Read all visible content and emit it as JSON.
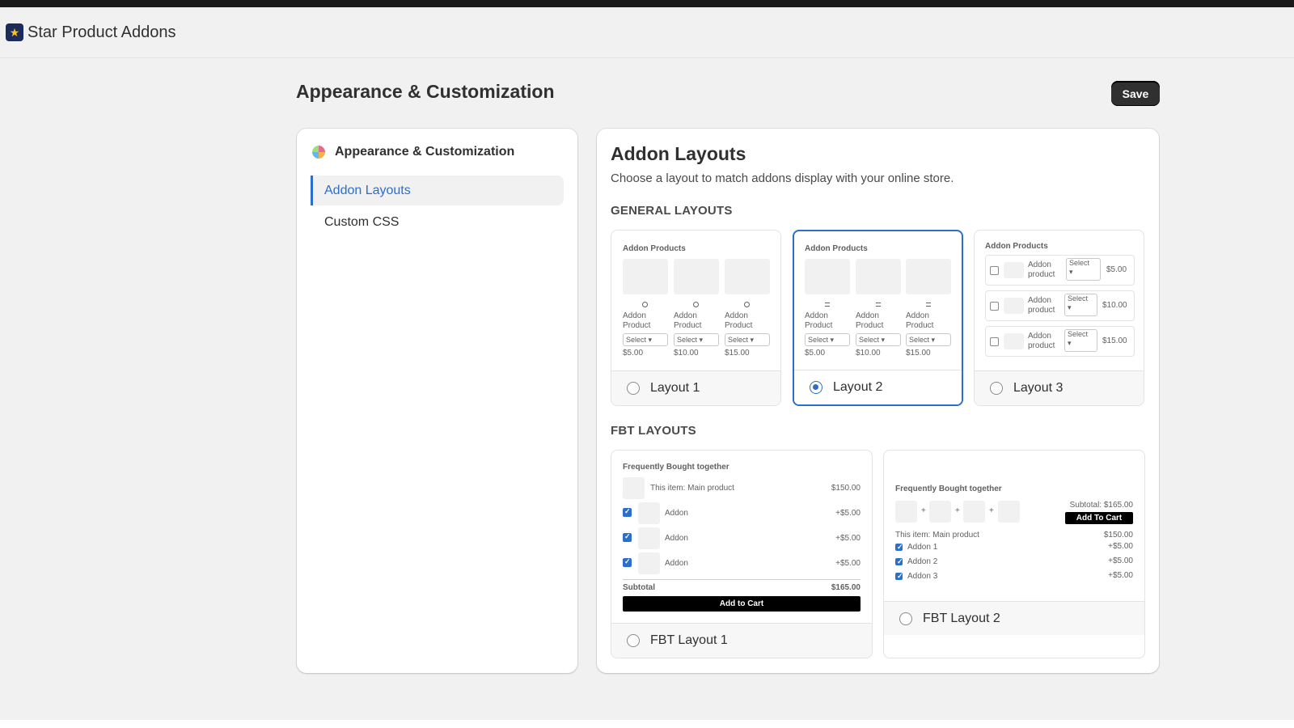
{
  "app": {
    "title": "Star Product Addons",
    "logo_icon": "star-logo-icon"
  },
  "page": {
    "title": "Appearance & Customization",
    "save_label": "Save"
  },
  "sidebar": {
    "heading": "Appearance & Customization",
    "heading_icon": "palette-icon",
    "items": [
      {
        "label": "Addon Layouts",
        "active": true
      },
      {
        "label": "Custom CSS",
        "active": false
      }
    ]
  },
  "main": {
    "title": "Addon Layouts",
    "description": "Choose a layout to match addons display with your online store.",
    "general_heading": "GENERAL LAYOUTS",
    "fbt_heading": "FBT LAYOUTS",
    "accent_color": "#2c6ecb"
  },
  "layouts": [
    {
      "label": "Layout 1",
      "selected": false,
      "preview_title": "Addon Products",
      "products": [
        {
          "name_line1": "Addon",
          "name_line2": "Product",
          "select": "Select ▾",
          "price": "$5.00"
        },
        {
          "name_line1": "Addon",
          "name_line2": "Product",
          "select": "Select ▾",
          "price": "$10.00"
        },
        {
          "name_line1": "Addon",
          "name_line2": "Product",
          "select": "Select ▾",
          "price": "$15.00"
        }
      ]
    },
    {
      "label": "Layout 2",
      "selected": true,
      "preview_title": "Addon Products",
      "products": [
        {
          "name_line1": "Addon",
          "name_line2": "Product",
          "select": "Select ▾",
          "price": "$5.00"
        },
        {
          "name_line1": "Addon",
          "name_line2": "Product",
          "select": "Select ▾",
          "price": "$10.00"
        },
        {
          "name_line1": "Addon",
          "name_line2": "Product",
          "select": "Select ▾",
          "price": "$15.00"
        }
      ]
    },
    {
      "label": "Layout 3",
      "selected": false,
      "preview_title": "Addon Products",
      "rows": [
        {
          "name_line1": "Addon",
          "name_line2": "product",
          "select_line1": "Select",
          "select_line2": "▾",
          "price": "$5.00"
        },
        {
          "name_line1": "Addon",
          "name_line2": "product",
          "select_line1": "Select",
          "select_line2": "▾",
          "price": "$10.00"
        },
        {
          "name_line1": "Addon",
          "name_line2": "product",
          "select_line1": "Select",
          "select_line2": "▾",
          "price": "$15.00"
        }
      ]
    }
  ],
  "fbt_layouts": [
    {
      "label": "FBT Layout 1",
      "selected": false,
      "preview_title": "Frequently Bought together",
      "main_item": "This item: Main product",
      "main_price": "$150.00",
      "addons": [
        {
          "name": "Addon",
          "price": "+$5.00",
          "checked": true
        },
        {
          "name": "Addon",
          "price": "+$5.00",
          "checked": true
        },
        {
          "name": "Addon",
          "price": "+$5.00",
          "checked": true
        }
      ],
      "subtotal_label": "Subtotal",
      "subtotal_value": "$165.00",
      "cart_button": "Add to Cart"
    },
    {
      "label": "FBT Layout 2",
      "selected": false,
      "preview_title": "Frequently Bought together",
      "subtotal": "Subtotal: $165.00",
      "cart_button": "Add To Cart",
      "main_item": "This item: Main product",
      "main_price": "$150.00",
      "addons": [
        {
          "name": "Addon 1",
          "price": "+$5.00",
          "checked": true
        },
        {
          "name": "Addon 2",
          "price": "+$5.00",
          "checked": true
        },
        {
          "name": "Addon 3",
          "price": "+$5.00",
          "checked": true
        }
      ],
      "plus_sign": "+"
    }
  ]
}
